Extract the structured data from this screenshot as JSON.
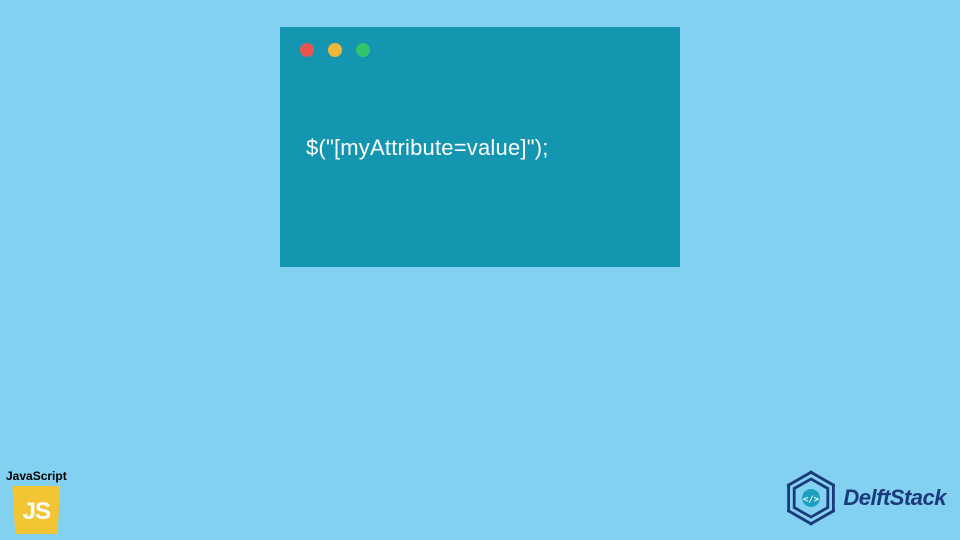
{
  "code_window": {
    "content": "$(\"[myAttribute=value]\");",
    "colors": {
      "background": "#1495b0",
      "text": "#ffffff",
      "dot_red": "#e8554f",
      "dot_yellow": "#ecb637",
      "dot_green": "#34c46b"
    }
  },
  "js_badge": {
    "label": "JavaScript",
    "logo_text": "JS",
    "logo_bg": "#f1c533"
  },
  "brand": {
    "name": "DelftStack",
    "color": "#1b3a7a"
  },
  "page": {
    "background": "#82d1f1"
  }
}
